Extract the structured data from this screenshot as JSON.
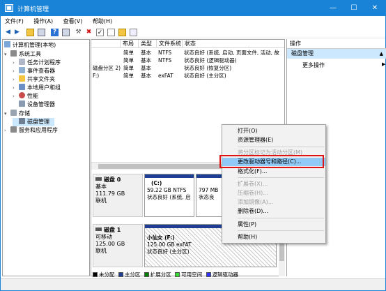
{
  "window": {
    "title": "计算机管理",
    "min": "—",
    "max": "☐",
    "close": "✕"
  },
  "menu": [
    "文件(F)",
    "操作(A)",
    "查看(V)",
    "帮助(H)"
  ],
  "tree": {
    "root": "计算机管理(本地)",
    "system_tools": "系统工具",
    "task_scheduler": "任务计划程序",
    "event_viewer": "事件查看器",
    "shared_folders": "共享文件夹",
    "local_users": "本地用户和组",
    "performance": "性能",
    "device_manager": "设备管理器",
    "storage": "存储",
    "disk_management": "磁盘管理",
    "services": "服务和应用程序"
  },
  "volume_table": {
    "headers": [
      "布局",
      "类型",
      "文件系统",
      "状态"
    ],
    "rows": [
      {
        "name": "",
        "layout": "简单",
        "type": "基本",
        "fs": "NTFS",
        "status": "状态良好 (系统, 启动, 页面文件, 活动, 故"
      },
      {
        "name": "",
        "layout": "简单",
        "type": "基本",
        "fs": "NTFS",
        "status": "状态良好 (逻辑驱动器)"
      },
      {
        "name": "磁盘分区 2)",
        "layout": "简单",
        "type": "基本",
        "fs": "",
        "status": "状态良好 (恢复分区)"
      },
      {
        "name": "F:)",
        "layout": "简单",
        "type": "基本",
        "fs": "exFAT",
        "status": "状态良好 (主分区)"
      }
    ]
  },
  "disk0": {
    "label": "磁盘 0",
    "type": "基本",
    "size": "111.79 GB",
    "state": "联机",
    "part_c": {
      "name": "(C:)",
      "size": "59.22 GB NTFS",
      "status": "状态良好 (系统, 启"
    },
    "part_2": {
      "size": "797 MB",
      "status": "状态良"
    }
  },
  "disk1": {
    "label": "磁盘 1",
    "type": "可移动",
    "size": "125.00 GB",
    "state": "联机",
    "part_f": {
      "name": "小仙女 (F:)",
      "size": "125.00 GB exFAT",
      "status": "状态良好 (主分区)"
    }
  },
  "legend": [
    "未分配",
    "主分区",
    "扩展分区",
    "可用空间",
    "逻辑驱动器"
  ],
  "actions": {
    "header": "操作",
    "section": "磁盘管理",
    "more": "更多操作"
  },
  "context_menu": {
    "open": "打开(O)",
    "explore": "资源管理器(E)",
    "mark_active": "将分区标记为活动分区(M)",
    "change_letter": "更改驱动器号和路径(C)...",
    "format": "格式化(F)...",
    "extend": "扩展卷(X)...",
    "shrink": "压缩卷(H)...",
    "add_mirror": "添加镜像(A)...",
    "delete": "删除卷(D)...",
    "properties": "属性(P)",
    "help": "帮助(H)"
  },
  "colors": {
    "titlebar": "#1883d7",
    "primary": "#1f3e93",
    "unallocated": "#000000",
    "extended": "#008000",
    "free": "#33dd33",
    "logical": "#3232ff",
    "highlight": "#91c9f7",
    "red_box": "#e01414"
  }
}
